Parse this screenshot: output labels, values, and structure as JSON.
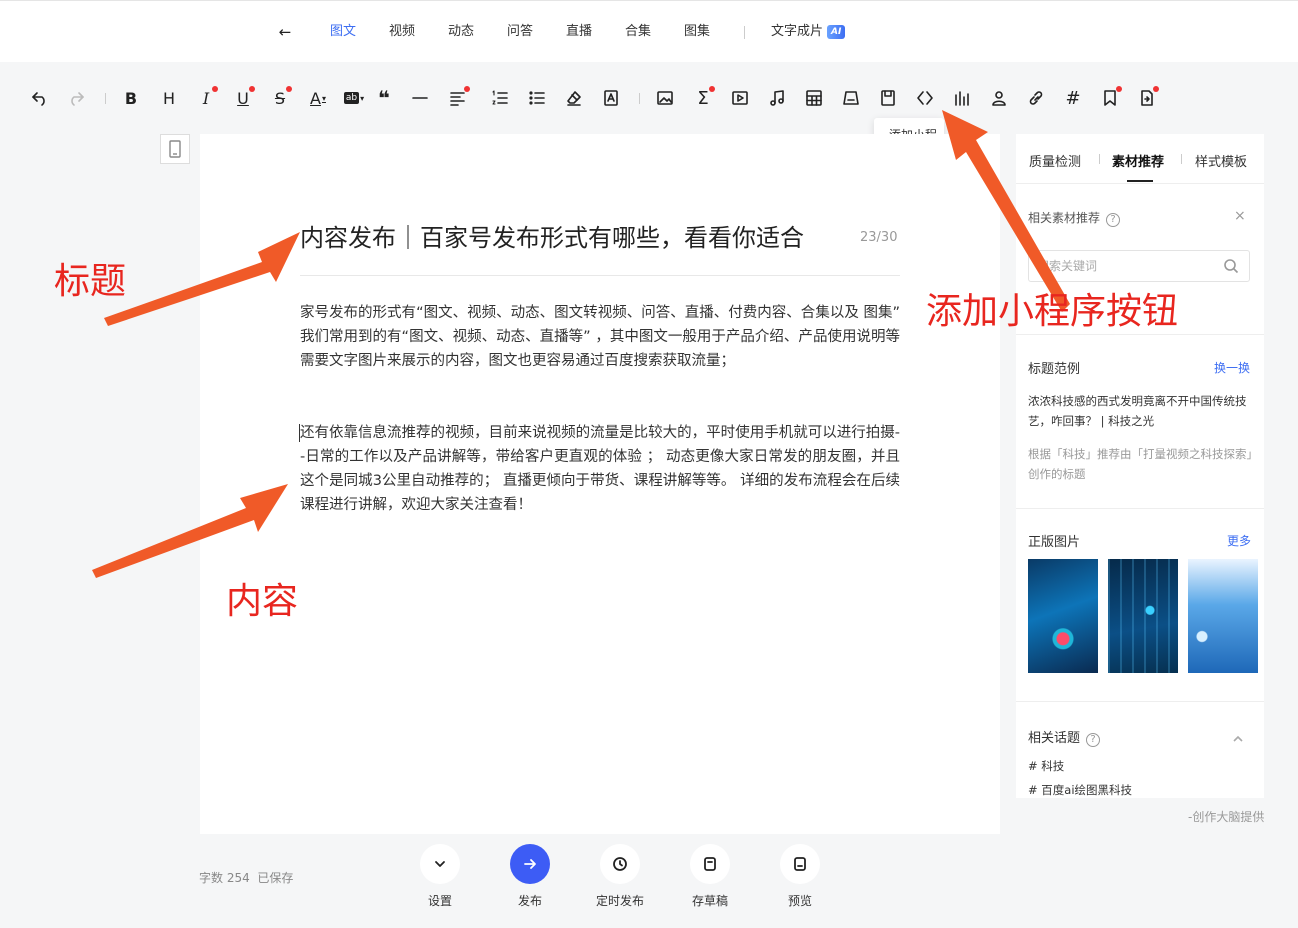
{
  "nav": {
    "tabs": [
      {
        "label": "图文",
        "active": true
      },
      {
        "label": "视频"
      },
      {
        "label": "动态"
      },
      {
        "label": "问答"
      },
      {
        "label": "直播"
      },
      {
        "label": "合集"
      },
      {
        "label": "图集"
      }
    ],
    "text_to_video": "文字成片",
    "ai_badge": "AI"
  },
  "toolbar": {
    "tooltip": "添加小程"
  },
  "editor": {
    "title": "内容发布｜百家号发布形式有哪些，看看你适合",
    "title_count": "23/30",
    "paragraph1": "家号发布的形式有“图文、视频、动态、图文转视频、问答、直播、付费内容、合集以及 图集” 我们常用到的有“图文、视频、动态、直播等” ，其中图文一般用于产品介绍、产品使用说明等需要文字图片来展示的内容，图文也更容易通过百度搜索获取流量；",
    "paragraph2": "还有依靠信息流推荐的视频，目前来说视频的流量是比较大的，平时使用手机就可以进行拍摄--日常的工作以及产品讲解等，带给客户更直观的体验 ； 动态更像大家日常发的朋友圈，并且这个是同城3公里自动推荐的； 直播更倾向于带货、课程讲解等等。 详细的发布流程会在后续课程进行讲解，欢迎大家关注查看！"
  },
  "panel": {
    "tabs": [
      {
        "label": "质量检测"
      },
      {
        "label": "素材推荐",
        "active": true
      },
      {
        "label": "样式模板"
      }
    ],
    "material": {
      "title": "相关素材推荐",
      "help": "?",
      "close": "×",
      "search_placeholder": "搜索关键词"
    },
    "title_examples": {
      "title": "标题范例",
      "refresh": "换一换",
      "example": "浓浓科技感的西式发明竟离不开中国传统技艺，咋回事？ | 科技之光",
      "note": "根据「科技」推荐由「打量视频之科技探索」创作的标题"
    },
    "images": {
      "title": "正版图片",
      "more": "更多"
    },
    "topics": {
      "title": "相关话题",
      "help": "?",
      "items": [
        "# 科技",
        "# 百度ai绘图黑科技"
      ]
    },
    "provider": "-创作大脑提供"
  },
  "footer": {
    "word_count": "字数 254",
    "saved": "已保存",
    "buttons": [
      {
        "label": "设置"
      },
      {
        "label": "发布"
      },
      {
        "label": "定时发布"
      },
      {
        "label": "存草稿"
      },
      {
        "label": "预览"
      }
    ]
  },
  "annotations": {
    "title_label": "标题",
    "content_label": "内容",
    "mini_program_label": "添加小程序按钮",
    "color": "#e8261f"
  },
  "colors": {
    "accent": "#3d6ef2",
    "publish": "#3d5cf5",
    "arrow": "#f05a28"
  }
}
